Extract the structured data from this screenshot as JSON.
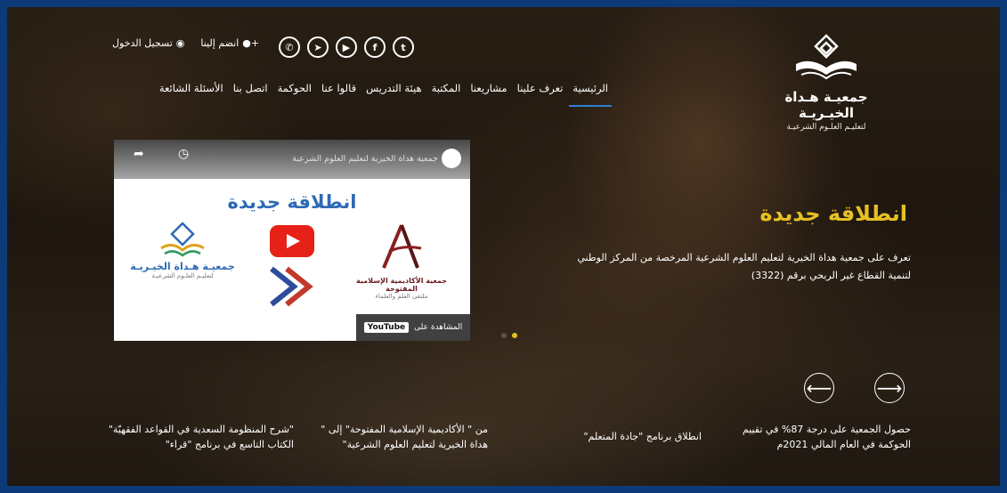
{
  "header": {
    "social": [
      "whatsapp-icon",
      "telegram-icon",
      "youtube-icon",
      "facebook-icon",
      "twitter-icon"
    ],
    "join_label": "انضم إلينا",
    "login_label": "تسجيل الدخول"
  },
  "nav": {
    "items": [
      "الرئيسية",
      "تعرف علينا",
      "مشاريعنا",
      "المكتبة",
      "هيئة التدريس",
      "قالوا عنا",
      "الحوكمة",
      "اتصل بنا",
      "الأسئلة الشائعة"
    ]
  },
  "logo": {
    "name": "جمعيـة هـداة الخيـريـة",
    "sub": "لتعليـم العلـوم الشرعيـة"
  },
  "hero": {
    "headline": "انطلاقة جديدة",
    "description": "تعرف على جمعية هداة الخيرية لتعليم العلوم الشرعية المرخصة من المركز الوطني لتنمية القطاع غير الربحي برقم (3322)"
  },
  "video": {
    "title": "جمعية هداة الخيرية لتعليم العلوم الشرعية",
    "big_text": "انطلاقة جديدة",
    "logo_right_name": "جمعية الأكاديمية الإسلامية المفتوحة",
    "logo_right_sub": "ملتقى العلم والعلماء",
    "logo_left_name": "جمعيـة هـداة الخيـريـة",
    "logo_left_sub": "لتعليـم العلـوم الشرعيـة",
    "watch_on": "المشاهدة على",
    "youtube": "YouTube",
    "accent": "#e62117"
  },
  "news": [
    {
      "text": "حصول الجمعية على درجة 87% في تقييم الحوكمة في العام المالي 2021م"
    },
    {
      "text": "انطلاق برنامج \"جادة المتعلم\""
    },
    {
      "text": "من \" الأكاديمية الإسلامية المفتوحة\" إلى \" هداة الخيرية لتعليم العلوم الشرعية\""
    },
    {
      "text": "\"شرح المنظومة السعدية في القواعد الفقهيّة\" الكتاب التاسع في برنامج \"قراء\""
    }
  ],
  "colors": {
    "gold": "#e6c023",
    "nav_active": "#2e7fd8",
    "dot_active": "#e6c023"
  }
}
